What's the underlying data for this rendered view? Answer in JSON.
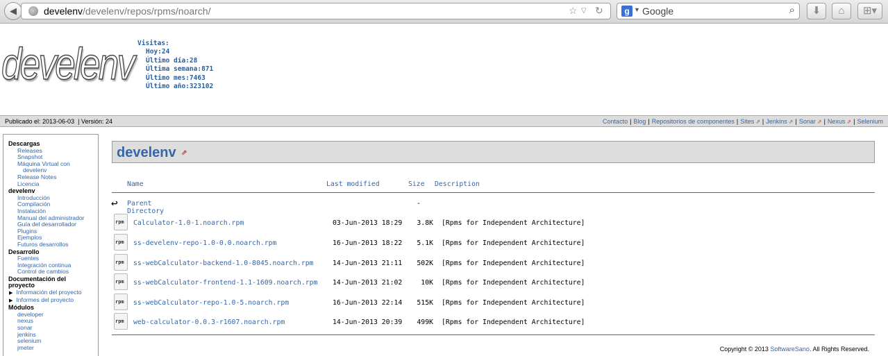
{
  "browser": {
    "url_host": "develenv",
    "url_path": "/develenv/repos/rpms/noarch/",
    "search_engine": "Google",
    "search_placeholder": "Google"
  },
  "banner": {
    "logo_text": "develenv",
    "visits_title": "Visitas:",
    "visits": [
      "Hoy:24",
      "Último día:28",
      "Última semana:871",
      "Último mes:7463",
      "Último año:323102"
    ]
  },
  "breadcrumb": {
    "published": "Publicado el: 2013-06-03",
    "version": "| Versión: 24",
    "links": [
      {
        "label": "Contacto",
        "external": false
      },
      {
        "label": "Blog",
        "external": false
      },
      {
        "label": "Repositorios de componentes",
        "external": false
      },
      {
        "label": "Sites",
        "external": true
      },
      {
        "label": "Jenkins",
        "external": true
      },
      {
        "label": "Sonar",
        "external": true
      },
      {
        "label": "Nexus",
        "external": true
      },
      {
        "label": "Selenium",
        "external": false
      }
    ]
  },
  "nav": {
    "sections": [
      {
        "title": "Descargas",
        "items": [
          "Releases",
          "Snapshot",
          "Máquina Virtual con",
          "develenv",
          "Release Notes",
          "Licencia"
        ]
      },
      {
        "title": "develenv",
        "items": [
          "Introducción",
          "Compilación",
          "Instalación",
          "Manual del administrador",
          "Guía del desarrollador",
          "Plugins",
          "Ejemplos",
          "Futuros desarrollos"
        ]
      },
      {
        "title": "Desarrollo",
        "items": [
          "Fuentes",
          "Integración continua",
          "Control de cambios"
        ]
      },
      {
        "title": "Documentación del proyecto",
        "items": [
          "Información del proyecto",
          "Informes del proyecto"
        ]
      },
      {
        "title": "Módulos",
        "items": [
          "developer",
          "nexus",
          "sonar",
          "jenkins",
          "selenium",
          "jmeter"
        ]
      }
    ]
  },
  "main": {
    "title": "develenv",
    "columns": {
      "name": "Name",
      "modified": "Last modified",
      "size": "Size",
      "description": "Description"
    },
    "parent": {
      "label": "Parent Directory",
      "size": "-"
    },
    "files": [
      {
        "name": "Calculator-1.0-1.noarch.rpm",
        "modified": "03-Jun-2013 18:29",
        "size": "3.8K",
        "description": "[Rpms for Independent Architecture]"
      },
      {
        "name": "ss-develenv-repo-1.0-0.0.noarch.rpm",
        "modified": "16-Jun-2013 18:22",
        "size": "5.1K",
        "description": "[Rpms for Independent Architecture]"
      },
      {
        "name": "ss-webCalculator-backend-1.0-8045.noarch.rpm",
        "modified": "14-Jun-2013 21:11",
        "size": "502K",
        "description": "[Rpms for Independent Architecture]"
      },
      {
        "name": "ss-webCalculator-frontend-1.1-1609.noarch.rpm",
        "modified": "14-Jun-2013 21:02",
        "size": "10K",
        "description": "[Rpms for Independent Architecture]"
      },
      {
        "name": "ss-webCalculator-repo-1.0-5.noarch.rpm",
        "modified": "16-Jun-2013 22:14",
        "size": "515K",
        "description": "[Rpms for Independent Architecture]"
      },
      {
        "name": "web-calculator-0.0.3-r1607.noarch.rpm",
        "modified": "14-Jun-2013 20:39",
        "size": "499K",
        "description": "[Rpms for Independent Architecture]"
      }
    ],
    "file_icon_label": "rpm"
  },
  "footer": {
    "copyright_prefix": "Copyright © 2013",
    "company": "SoftwareSano",
    "suffix": ". All Rights Reserved."
  }
}
